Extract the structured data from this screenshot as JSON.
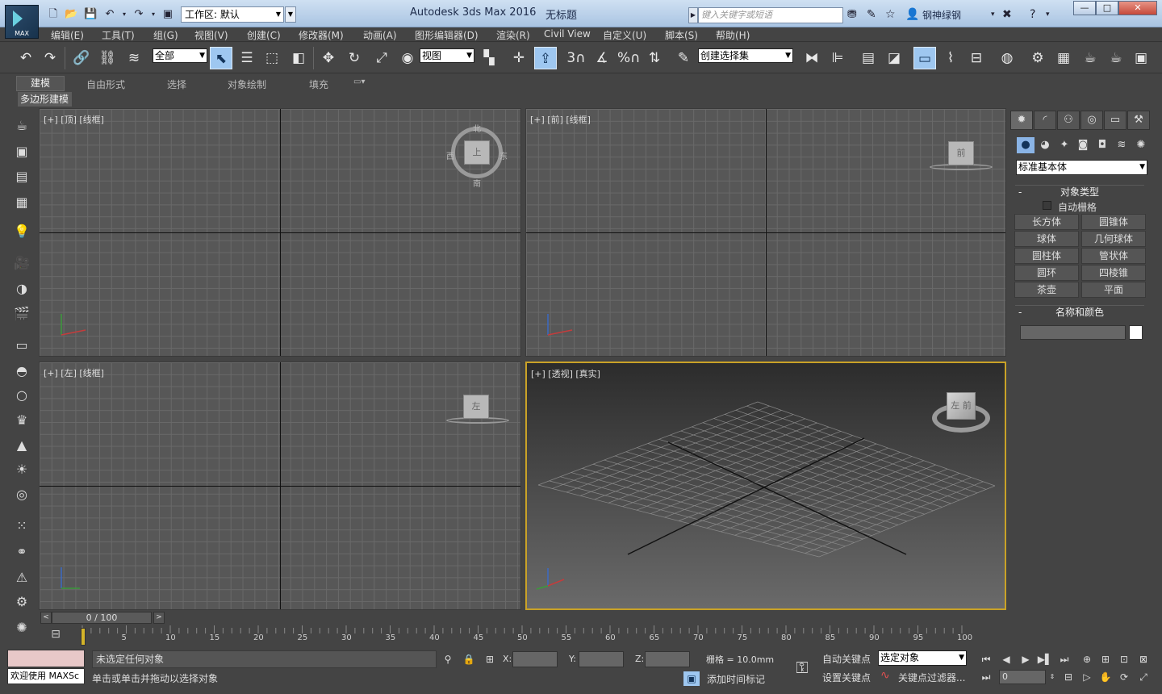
{
  "title": {
    "workspace_label": "工作区: 默认",
    "app_title": "Autodesk 3ds Max 2016",
    "file_name": "无标题",
    "search_placeholder": "键入关键字或短语",
    "user_name": "钢神绿钢",
    "logo_text": "MAX",
    "window_buttons": [
      "—",
      "□",
      "✕"
    ]
  },
  "menu": [
    "编辑(E)",
    "工具(T)",
    "组(G)",
    "视图(V)",
    "创建(C)",
    "修改器(M)",
    "动画(A)",
    "图形编辑器(D)",
    "渲染(R)",
    "Civil View",
    "自定义(U)",
    "脚本(S)",
    "帮助(H)"
  ],
  "toolbar": {
    "filter_value": "全部",
    "refcoord_value": "视图",
    "selset_value": "创建选择集",
    "snap_labels": [
      "3",
      "%"
    ]
  },
  "ribbon": {
    "tabs": [
      "建模",
      "自由形式",
      "选择",
      "对象绘制",
      "填充"
    ],
    "panel_label": "多边形建模"
  },
  "viewports": [
    {
      "label": "[+] [顶] [线框]",
      "cube_text": "上",
      "nav_labels": [
        "北",
        "西",
        "东",
        "南"
      ]
    },
    {
      "label": "[+] [前] [线框]",
      "cube_text": "前"
    },
    {
      "label": "[+] [左] [线框]",
      "cube_text": "左"
    },
    {
      "label": "[+] [透视] [真实]",
      "cube_text": "左 前"
    }
  ],
  "command_panel": {
    "category": "标准基本体",
    "rollout_object_type": "对象类型",
    "autogrid_label": "自动栅格",
    "primitives": [
      "长方体",
      "圆锥体",
      "球体",
      "几何球体",
      "圆柱体",
      "管状体",
      "圆环",
      "四棱锥",
      "茶壶",
      "平面"
    ],
    "rollout_name_color": "名称和颜色",
    "rollout_minus": "-",
    "object_color": "#ffffff"
  },
  "timeline": {
    "slider_text": "0 / 100",
    "ticks": [
      "5",
      "10",
      "15",
      "20",
      "25",
      "30",
      "35",
      "40",
      "45",
      "50",
      "55",
      "60",
      "65",
      "70",
      "75",
      "80",
      "85",
      "90",
      "95",
      "100"
    ]
  },
  "status": {
    "welcome": "欢迎使用 MAXSc",
    "selection_status": "未选定任何对象",
    "prompt": "单击或单击并拖动以选择对象",
    "x_label": "X:",
    "y_label": "Y:",
    "z_label": "Z:",
    "grid_label": "栅格 = 10.0mm",
    "add_time_tag": "添加时间标记",
    "auto_key": "自动关键点",
    "set_key": "设置关键点",
    "key_mode_value": "选定对象",
    "key_filters": "关键点过滤器...",
    "frame_value": "0"
  },
  "colors": {
    "active_viewport_border": "#c9a227",
    "active_tool": "#9ec7f0",
    "viewport_bg": "#575757"
  }
}
